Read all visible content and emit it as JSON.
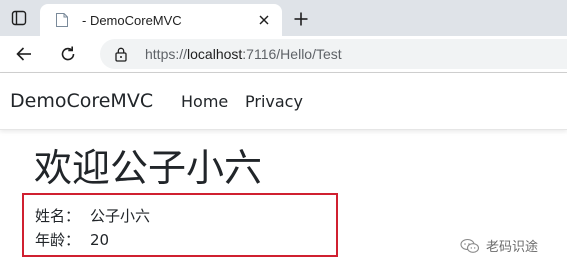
{
  "browser": {
    "tab": {
      "title": "- DemoCoreMVC"
    },
    "address_bar": {
      "scheme": "https://",
      "host": "localhost",
      "rest": ":7116/Hello/Test"
    }
  },
  "navbar": {
    "brand": "DemoCoreMVC",
    "links": [
      {
        "label": "Home"
      },
      {
        "label": "Privacy"
      }
    ]
  },
  "main": {
    "heading": "欢迎公子小六",
    "details": [
      {
        "label": "姓名：",
        "value": "公子小六"
      },
      {
        "label": "年龄：",
        "value": "20"
      }
    ]
  },
  "watermark": {
    "text": "老码识途"
  },
  "colors": {
    "tabstrip_bg": "#dfe3e8",
    "highlight_border": "#d02030",
    "omnibox_bg": "#f1f3f4"
  }
}
